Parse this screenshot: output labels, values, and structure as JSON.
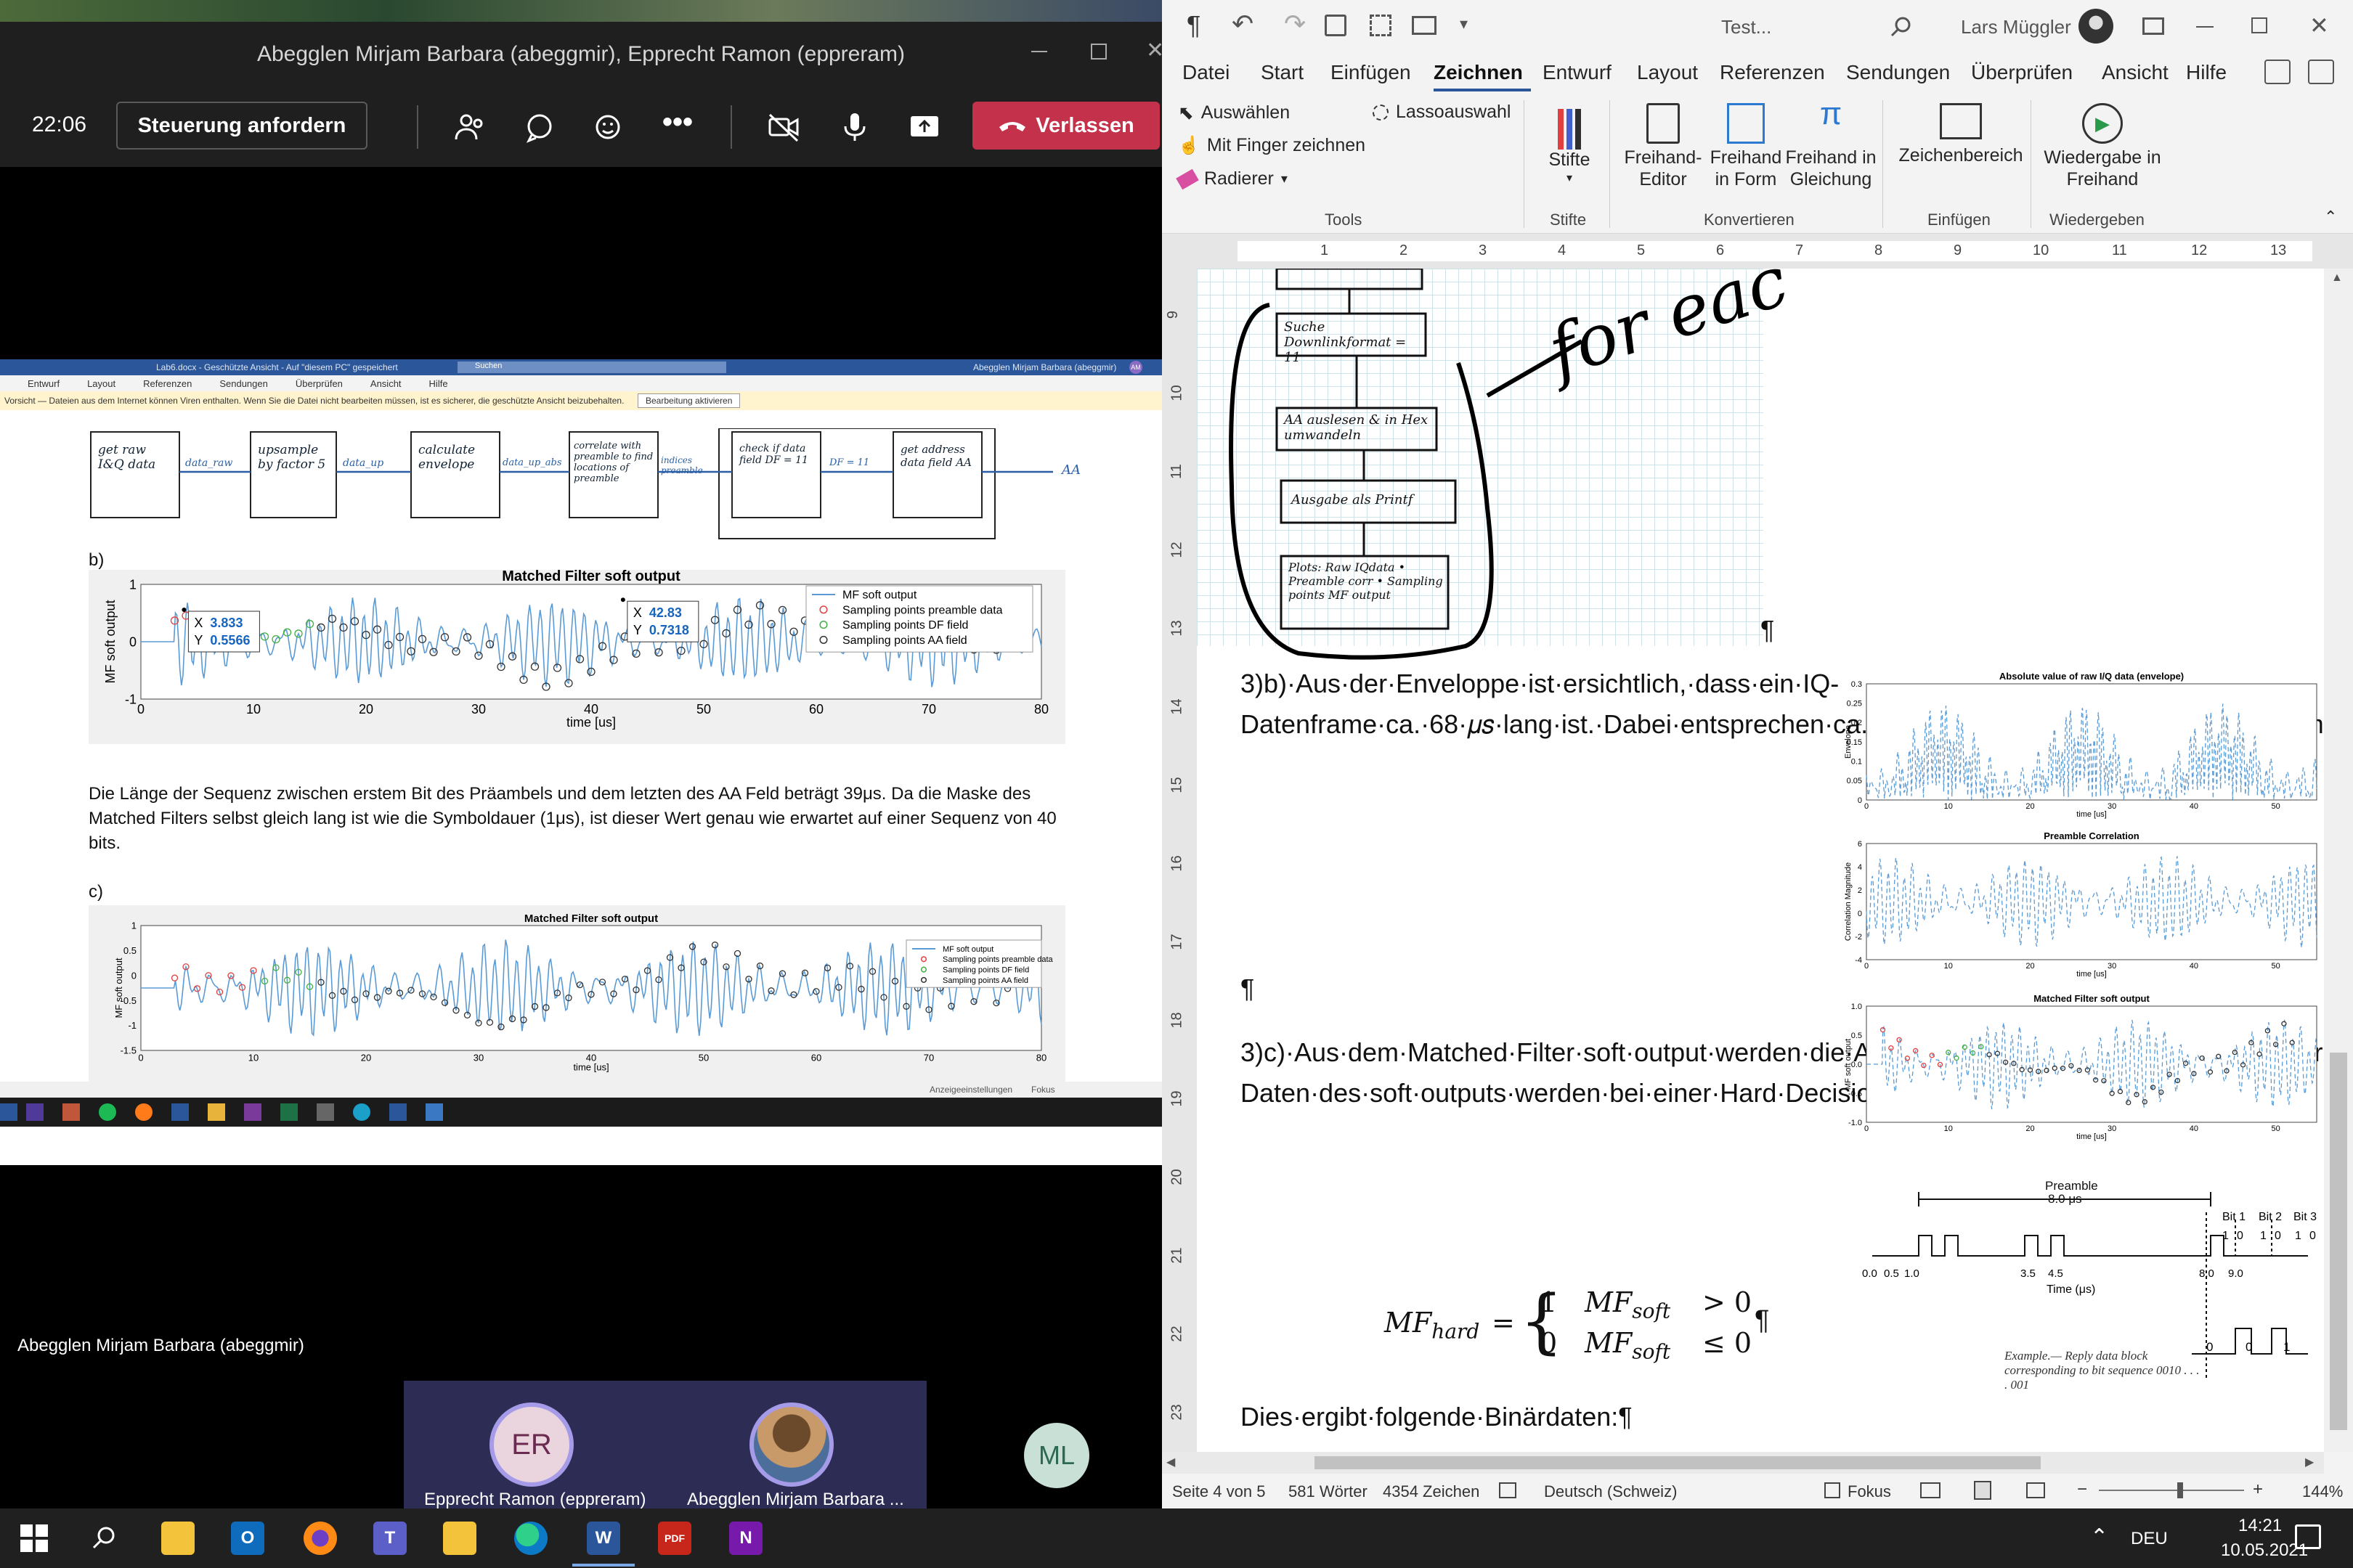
{
  "teams": {
    "window_title": "Abegglen Mirjam Barbara (abeggmir), Epprecht Ramon (eppreram)",
    "time": "22:06",
    "control_button": "Steuerung anfordern",
    "leave_button": "Verlassen",
    "presenter_name": "Abegglen Mirjam Barbara (abeggmir)",
    "participants": [
      {
        "initials": "ER",
        "name": "Epprecht Ramon (eppreram)"
      },
      {
        "initials": "",
        "name": "Abegglen Mirjam Barbara ..."
      },
      {
        "initials": "ML",
        "name": ""
      }
    ]
  },
  "shared_doc": {
    "title": "Lab6.docx - Geschützte Ansicht - Auf \"diesem PC\" gespeichert",
    "search": "Suchen",
    "user": "Abegglen Mirjam Barbara (abeggmir)",
    "user_initials": "AM",
    "menu": [
      "Entwurf",
      "Layout",
      "Referenzen",
      "Sendungen",
      "Überprüfen",
      "Ansicht",
      "Hilfe"
    ],
    "warning": "Vorsicht — Dateien aus dem Internet können Viren enthalten. Wenn Sie die Datei nicht bearbeiten müssen, ist es sicherer, die geschützte Ansicht beizubehalten.",
    "enable_editing": "Bearbeitung aktivieren",
    "flow_boxes": [
      "get raw I&Q data",
      "upsample by factor 5",
      "calculate envelope",
      "correlate with preamble to find locations of preamble",
      "check if data field DF = 11",
      "get address data field AA"
    ],
    "flow_arrows": [
      "data_raw",
      "data_up",
      "data_up_abs",
      "indices preamble",
      "DF = 11",
      "AA"
    ],
    "label_b": "b)",
    "label_c": "c)",
    "paragraph": "Die Länge der Sequenz zwischen erstem Bit des Präambels und dem letzten des AA Feld beträgt 39μs. Da die Maske des Matched Filters selbst gleich lang ist wie die Symboldauer (1μs), ist dieser Wert genau wie erwartet auf einer Sequenz von 40 bits.",
    "status_items": [
      "Anzeigeeinstellungen",
      "Fokus"
    ]
  },
  "chart_data": [
    {
      "type": "line",
      "title": "Matched Filter soft output",
      "xlabel": "time [us]",
      "ylabel": "MF soft output",
      "xlim": [
        0,
        80
      ],
      "ylim": [
        -1,
        1
      ],
      "x_ticks": [
        "0",
        "10",
        "20",
        "30",
        "40",
        "50",
        "60",
        "70",
        "80"
      ],
      "y_ticks": [
        "1",
        "0",
        "-1"
      ],
      "series": [
        {
          "name": "MF soft output"
        },
        {
          "name": "Sampling points preamble data"
        },
        {
          "name": "Sampling points DF field"
        },
        {
          "name": "Sampling points AA field"
        }
      ],
      "datatips": [
        {
          "x_label": "X",
          "x": "3.833",
          "y_label": "Y",
          "y": "0.5566"
        },
        {
          "x_label": "X",
          "x": "42.83",
          "y_label": "Y",
          "y": "0.7318"
        }
      ]
    },
    {
      "type": "line",
      "title": "Matched Filter soft output",
      "xlabel": "time [us]",
      "ylabel": "MF soft output",
      "xlim": [
        0,
        80
      ],
      "ylim": [
        -1.5,
        1
      ],
      "x_ticks": [
        "0",
        "10",
        "20",
        "30",
        "40",
        "50",
        "60",
        "70",
        "80"
      ],
      "y_ticks": [
        "1",
        "0.5",
        "0",
        "-0.5",
        "-1",
        "-1.5"
      ],
      "series": [
        {
          "name": "MF soft output"
        },
        {
          "name": "Sampling points preamble data"
        },
        {
          "name": "Sampling points DF field"
        },
        {
          "name": "Sampling points AA field"
        }
      ]
    },
    {
      "type": "line",
      "title": "Absolute value of raw I/Q data (envelope)",
      "xlabel": "time [us]",
      "ylabel": "Envelope",
      "xlim": [
        0,
        55
      ],
      "ylim": [
        0,
        0.3
      ],
      "x_ticks": [
        "0",
        "10",
        "20",
        "30",
        "40",
        "50"
      ],
      "y_ticks": [
        "0.3",
        "0.25",
        "0.2",
        "0.15",
        "0.1",
        "0.05",
        "0"
      ]
    },
    {
      "type": "line",
      "title": "Preamble Correlation",
      "xlabel": "time [us]",
      "ylabel": "Correlation Magnitude",
      "xlim": [
        0,
        55
      ],
      "ylim": [
        -4,
        6
      ],
      "x_ticks": [
        "0",
        "10",
        "20",
        "30",
        "40",
        "50"
      ],
      "y_ticks": [
        "6",
        "4",
        "2",
        "0",
        "-2",
        "-4"
      ]
    },
    {
      "type": "line",
      "title": "Matched Filter soft output",
      "xlabel": "time [us]",
      "ylabel": "MF soft output",
      "xlim": [
        0,
        55
      ],
      "ylim": [
        -1,
        1
      ],
      "x_ticks": [
        "0",
        "10",
        "20",
        "30",
        "40",
        "50"
      ],
      "y_ticks": [
        "1.0",
        "0.5",
        "0.0",
        "-0.5",
        "-1.0"
      ]
    }
  ],
  "word": {
    "title": "Test...",
    "user": "Lars Müggler",
    "tabs": [
      "Datei",
      "Start",
      "Einfügen",
      "Zeichnen",
      "Entwurf",
      "Layout",
      "Referenzen",
      "Sendungen",
      "Überprüfen",
      "Ansicht",
      "Hilfe"
    ],
    "active_tab": "Zeichnen",
    "ribbon": {
      "tools": [
        "Auswählen",
        "Lassoauswahl",
        "Mit Finger zeichnen",
        "Radierer"
      ],
      "stifte": "Stifte",
      "convert": [
        "Freihand-Editor",
        "Freihand in Form",
        "Freihand in Gleichung"
      ],
      "insert": "Zeichenbereich",
      "replay": "Wiedergabe in Freihand",
      "groups": [
        "Tools",
        "Stifte",
        "Konvertieren",
        "Einfügen",
        "Wiedergeben"
      ]
    },
    "ruler_numbers": [
      "1",
      "2",
      "3",
      "4",
      "5",
      "6",
      "7",
      "8",
      "9",
      "10",
      "11",
      "12",
      "13"
    ],
    "vruler_numbers": [
      "9",
      "10",
      "11",
      "12",
      "13",
      "14",
      "15",
      "16",
      "17",
      "18",
      "19",
      "20",
      "21",
      "22",
      "23"
    ],
    "sketch": {
      "boxes": [
        "Suche Downlinkformat = 11",
        "AA auslesen & in Hex umwandeln",
        "Ausgabe als Printf",
        "Plots: Raw IQdata • Preamble corr • Sampling points MF output"
      ],
      "note": "for eac"
    },
    "para1": "3)b)·Aus·der·Enveloppe·ist·ersichtlich,·dass·ein·IQ-Datenframe·ca.·68·𝜇𝑠·lang·ist.·Dabei·entsprechen·ca.·8·𝜇𝑠·der·Präambel·und·ca.·60·𝜇𝑠·dem·Datenblock.·Laut·dem·DF11·Paketformat·ist·die·Präambel·8·𝜇𝑠·und·der·Datenblock·56·𝜇𝑠·lang.·Die·Messung·stimmt·mit·der·Theorie·sehr·gut·überein.¶",
    "para_empty": "¶",
    "para2": "3)c)·Aus·dem·Matched·Filter·soft·output·werden·die·Amplitudenwerte·zu·den·jeweilig·schwarzeingekreisten·Zeiten·abgelesen.·Diese·AA-Daten·des·soft·outputs·werden·bei·einer·Hard·Decision·wie·folgt·gemachted:¶",
    "formula": {
      "lhs": "MF",
      "lhs_sub": "hard",
      "case1_val": "1",
      "case1_cond": "MF",
      "case1_sub": "soft",
      "case1_rel": "> 0",
      "case2_val": "0",
      "case2_cond": "MF",
      "case2_sub": "soft",
      "case2_rel": "≤ 0",
      "pilcrow": "¶"
    },
    "para3": "Dies·ergibt·folgende·Binärdaten:¶",
    "pilcrow_top": "¶",
    "preamble_fig": {
      "label": "Preamble",
      "duration": "8.0 μs",
      "bits": [
        "Bit 1",
        "Bit 2",
        "Bit 3"
      ],
      "bit_values": [
        "1",
        "0",
        "1",
        "0",
        "1",
        "0"
      ],
      "ticks": [
        "0.0",
        "0.5",
        "1.0",
        "3.5",
        "4.5",
        "8.0",
        "9.0"
      ],
      "xlabel": "Time (μs)",
      "data_bits": [
        "0",
        "0",
        "1"
      ],
      "caption": "Example.— Reply data block corresponding to bit sequence 0010 . . . . 001"
    },
    "status": {
      "page": "Seite 4 von 5",
      "words": "581 Wörter",
      "chars": "4354 Zeichen",
      "language": "Deutsch (Schweiz)",
      "focus": "Fokus",
      "zoom": "144%"
    }
  },
  "taskbar": {
    "lang": "DEU",
    "time": "14:21",
    "date": "10.05.2021"
  }
}
